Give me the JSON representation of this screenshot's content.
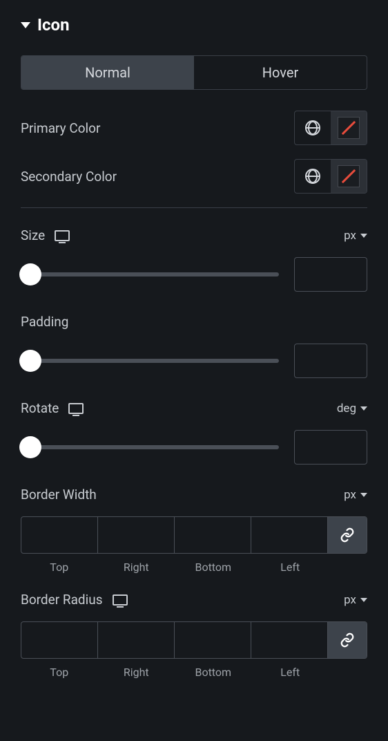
{
  "section_title": "Icon",
  "tabs": {
    "normal": "Normal",
    "hover": "Hover"
  },
  "primary_color_label": "Primary Color",
  "secondary_color_label": "Secondary Color",
  "size": {
    "label": "Size",
    "unit": "px",
    "value": ""
  },
  "padding": {
    "label": "Padding",
    "value": ""
  },
  "rotate": {
    "label": "Rotate",
    "unit": "deg",
    "value": ""
  },
  "border_width": {
    "label": "Border Width",
    "unit": "px",
    "top": "",
    "right": "",
    "bottom": "",
    "left": "",
    "side_labels": {
      "top": "Top",
      "right": "Right",
      "bottom": "Bottom",
      "left": "Left"
    }
  },
  "border_radius": {
    "label": "Border Radius",
    "unit": "px",
    "top": "",
    "right": "",
    "bottom": "",
    "left": "",
    "side_labels": {
      "top": "Top",
      "right": "Right",
      "bottom": "Bottom",
      "left": "Left"
    }
  }
}
